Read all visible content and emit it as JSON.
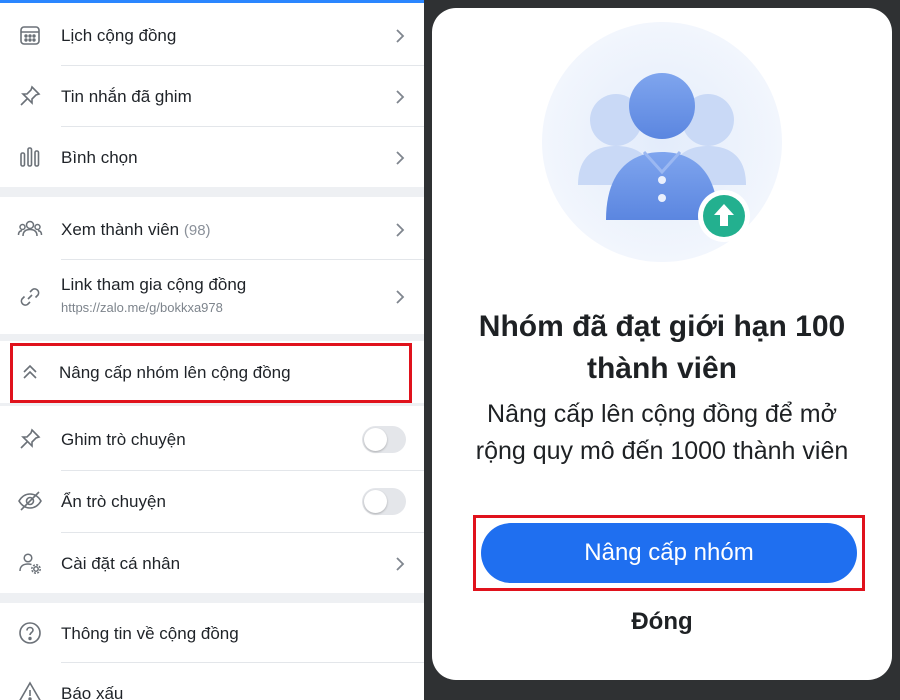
{
  "settings": {
    "items": [
      {
        "icon": "calendar-icon",
        "label": "Lịch cộng đồng"
      },
      {
        "icon": "pin-icon",
        "label": "Tin nhắn đã ghim"
      },
      {
        "icon": "poll-icon",
        "label": "Bình chọn"
      },
      {
        "icon": "members-icon",
        "label": "Xem thành viên",
        "count": "(98)"
      },
      {
        "icon": "link-icon",
        "label": "Link tham gia cộng đồng",
        "sub": "https://zalo.me/g/bokkxa978"
      },
      {
        "icon": "double-chevron-up-icon",
        "label": "Nâng cấp nhóm lên cộng đồng"
      },
      {
        "icon": "pin-icon",
        "label": "Ghim trò chuyện",
        "toggle": false
      },
      {
        "icon": "eye-off-icon",
        "label": "Ẩn trò chuyện",
        "toggle": false
      },
      {
        "icon": "user-settings-icon",
        "label": "Cài đặt cá nhân"
      },
      {
        "icon": "help-icon",
        "label": "Thông tin về cộng đồng"
      },
      {
        "icon": "warning-icon",
        "label": "Báo xấu"
      }
    ]
  },
  "modal": {
    "title_line1": "Nhóm đã đạt giới hạn 100",
    "title_line2": "thành viên",
    "desc_line1": "Nâng cấp lên cộng đồng để mở",
    "desc_line2": "rộng quy mô đến 1000 thành viên",
    "upgrade_label": "Nâng cấp nhóm",
    "close_label": "Đóng"
  },
  "colors": {
    "accent": "#1f6ff0",
    "highlight": "#e0121c",
    "section_bg": "#eef0f3"
  }
}
